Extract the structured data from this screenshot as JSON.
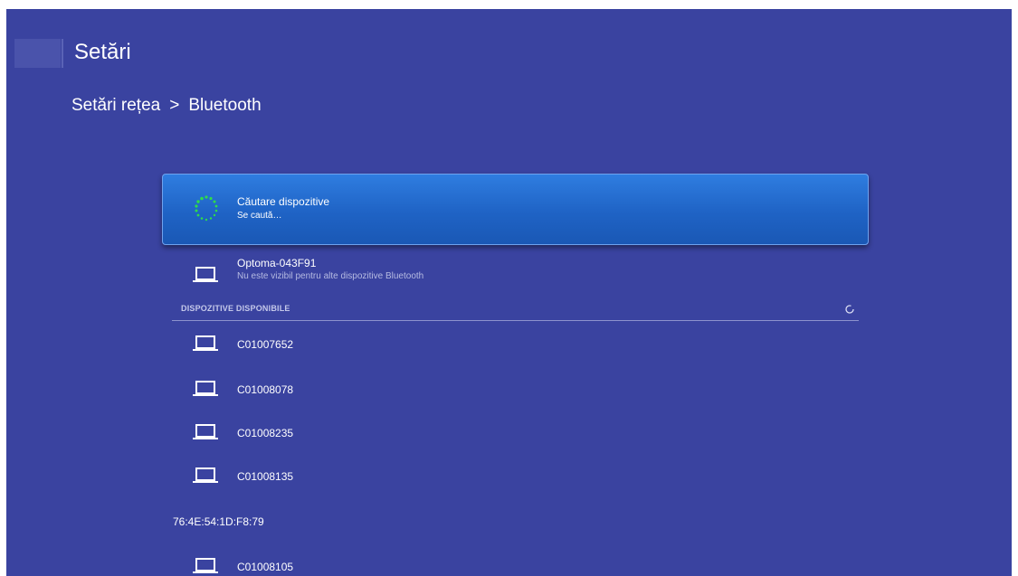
{
  "header": {
    "title": "Setări",
    "breadcrumb": {
      "parent": "Setări rețea",
      "separator": ">",
      "current": "Bluetooth"
    }
  },
  "scan_item": {
    "title": "Căutare dispozitive",
    "status": "Se caută…",
    "icon": "loading-spinner-icon",
    "color": "#1f63c5"
  },
  "own_device": {
    "name": "Optoma-043F91",
    "visibility": "Nu este vizibil pentru alte dispozitive Bluetooth",
    "icon": "laptop-icon"
  },
  "available": {
    "header": "DISPOZITIVE DISPONIBILE",
    "refresh_icon": "refresh-icon",
    "devices": [
      {
        "name": "C01007652",
        "icon": "laptop-icon"
      },
      {
        "name": "C01008078",
        "icon": "laptop-icon"
      },
      {
        "name": "C01008235",
        "icon": "laptop-icon"
      },
      {
        "name": "C01008135",
        "icon": "laptop-icon"
      },
      {
        "name": "76:4E:54:1D:F8:79",
        "icon": ""
      },
      {
        "name": "C01008105",
        "icon": "laptop-icon"
      }
    ]
  },
  "colors": {
    "background": "#3a43a0",
    "highlight": "#1f63c5",
    "spinner": "#2fdc4a",
    "icon": "#ffffff"
  }
}
